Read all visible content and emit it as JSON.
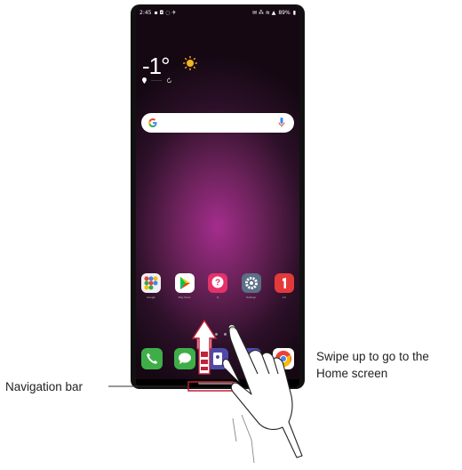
{
  "status_bar": {
    "time": "2:45",
    "battery": "89%"
  },
  "weather": {
    "temperature": "-1°",
    "location": "······"
  },
  "search": {
    "provider_icon": "google-g-icon",
    "voice_icon": "mic-icon"
  },
  "apps": [
    {
      "name": "Google",
      "color": "#ffffff",
      "icon": "folder-icon"
    },
    {
      "name": "Play Store",
      "color": "#ffffff",
      "icon": "play-store-icon"
    },
    {
      "name": "Q",
      "color": "#e5326b",
      "icon": "quick-help-icon"
    },
    {
      "name": "Settings",
      "color": "#5b6f86",
      "icon": "settings-icon"
    },
    {
      "name": "LG",
      "color": "#e23a3a",
      "icon": "update-icon"
    }
  ],
  "dock": [
    {
      "name": "Phone",
      "color": "#3fae49",
      "icon": "phone-icon"
    },
    {
      "name": "Messages",
      "color": "#3fae49",
      "icon": "messages-icon"
    },
    {
      "name": "Contacts",
      "color": "#4e4aa8",
      "icon": "contacts-icon"
    },
    {
      "name": "Camera",
      "color": "#4e4aa8",
      "icon": "camera-icon"
    },
    {
      "name": "Chrome",
      "color": "#ffffff",
      "icon": "chrome-icon"
    }
  ],
  "callouts": {
    "swipe_line1": "Swipe up to go to the",
    "swipe_line2": "Home screen",
    "navigation_bar": "Navigation bar"
  }
}
